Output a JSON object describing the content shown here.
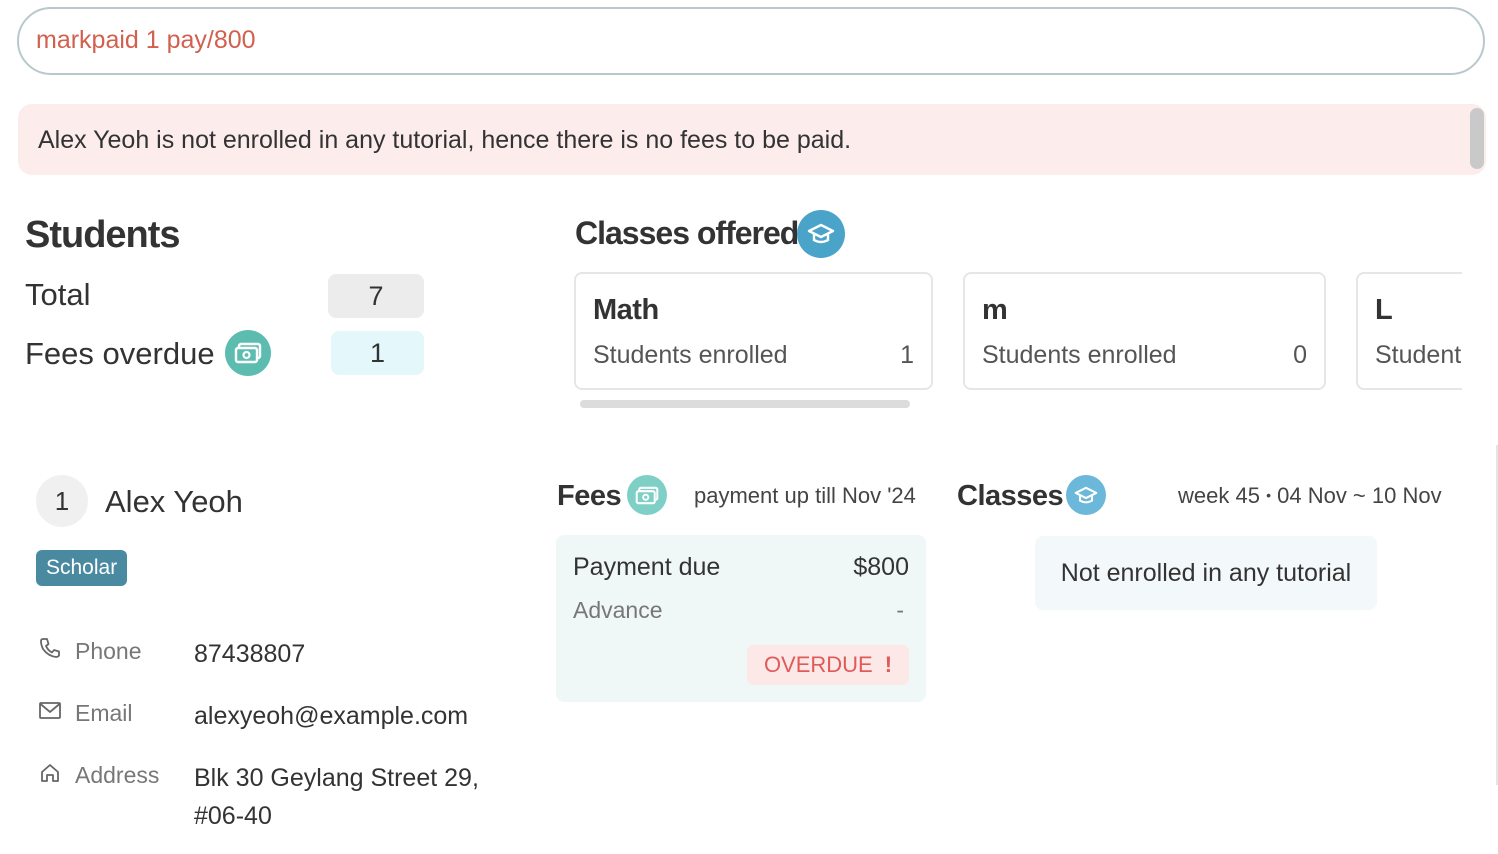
{
  "command": {
    "value": "markpaid 1 pay/800"
  },
  "result": {
    "message": "Alex Yeoh is not enrolled in any tutorial, hence there is no fees to be paid."
  },
  "students": {
    "title": "Students",
    "total_label": "Total",
    "total_value": "7",
    "overdue_label": "Fees overdue",
    "overdue_value": "1"
  },
  "classes_offered": {
    "title": "Classes offered",
    "cards": [
      {
        "name": "Math",
        "label": "Students enrolled",
        "count": "1"
      },
      {
        "name": "m",
        "label": "Students enrolled",
        "count": "0"
      },
      {
        "name": "L",
        "label": "Students enrolled",
        "count": ""
      }
    ]
  },
  "student": {
    "index": "1",
    "name": "Alex Yeoh",
    "tag": "Scholar",
    "phone_label": "Phone",
    "phone": "87438807",
    "email_label": "Email",
    "email": "alexyeoh@example.com",
    "address_label": "Address",
    "address_line1": "Blk 30 Geylang Street 29,",
    "address_line2": "#06-40"
  },
  "fees": {
    "title": "Fees",
    "subtitle": "payment up till Nov '24",
    "due_label": "Payment due",
    "due_value": "$800",
    "advance_label": "Advance",
    "advance_value": "-",
    "status": "OVERDUE",
    "status_mark": "!"
  },
  "classes": {
    "title": "Classes",
    "week": "week 45",
    "separator": "•",
    "range": "04 Nov ~ 10 Nov",
    "empty_message": "Not enrolled in any tutorial"
  },
  "icons": {
    "money": "money-icon",
    "graduation": "graduation-cap-icon",
    "phone": "phone-icon",
    "email": "mail-icon",
    "address": "home-icon"
  },
  "colors": {
    "command_text": "#d2604f",
    "error_bg": "#fcecec",
    "teal": "#5dbcb0",
    "blue": "#4aa3c9",
    "tag_bg": "#4a8aa0",
    "overdue_text": "#e05a5a",
    "fees_bg": "#f0f8f7",
    "classes_bg": "#f3f8fa"
  }
}
